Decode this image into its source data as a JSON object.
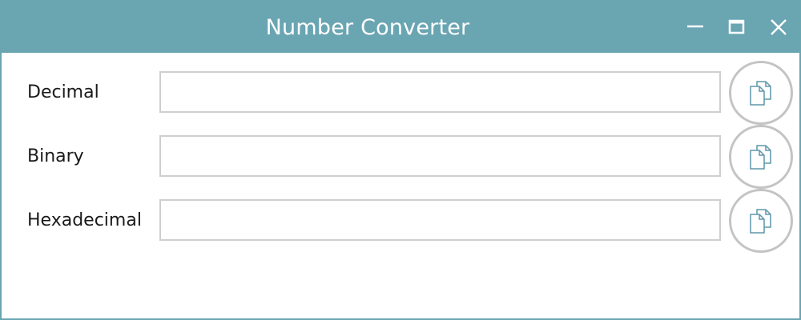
{
  "window": {
    "title": "Number Converter",
    "controls": {
      "minimize_icon": "minimize-icon",
      "maximize_icon": "maximize-icon",
      "close_icon": "close-icon"
    },
    "titlebar_color": "#6aa5b2"
  },
  "fields": [
    {
      "label": "Decimal",
      "value": "",
      "placeholder": "",
      "copy_icon": "copy-icon"
    },
    {
      "label": "Binary",
      "value": "",
      "placeholder": "",
      "copy_icon": "copy-icon"
    },
    {
      "label": "Hexadecimal",
      "value": "",
      "placeholder": "",
      "copy_icon": "copy-icon"
    }
  ],
  "colors": {
    "accent": "#6aa5b2",
    "input_border": "#cfcfcf",
    "button_border": "#c4c4c4",
    "icon_stroke": "#5f97a8"
  }
}
